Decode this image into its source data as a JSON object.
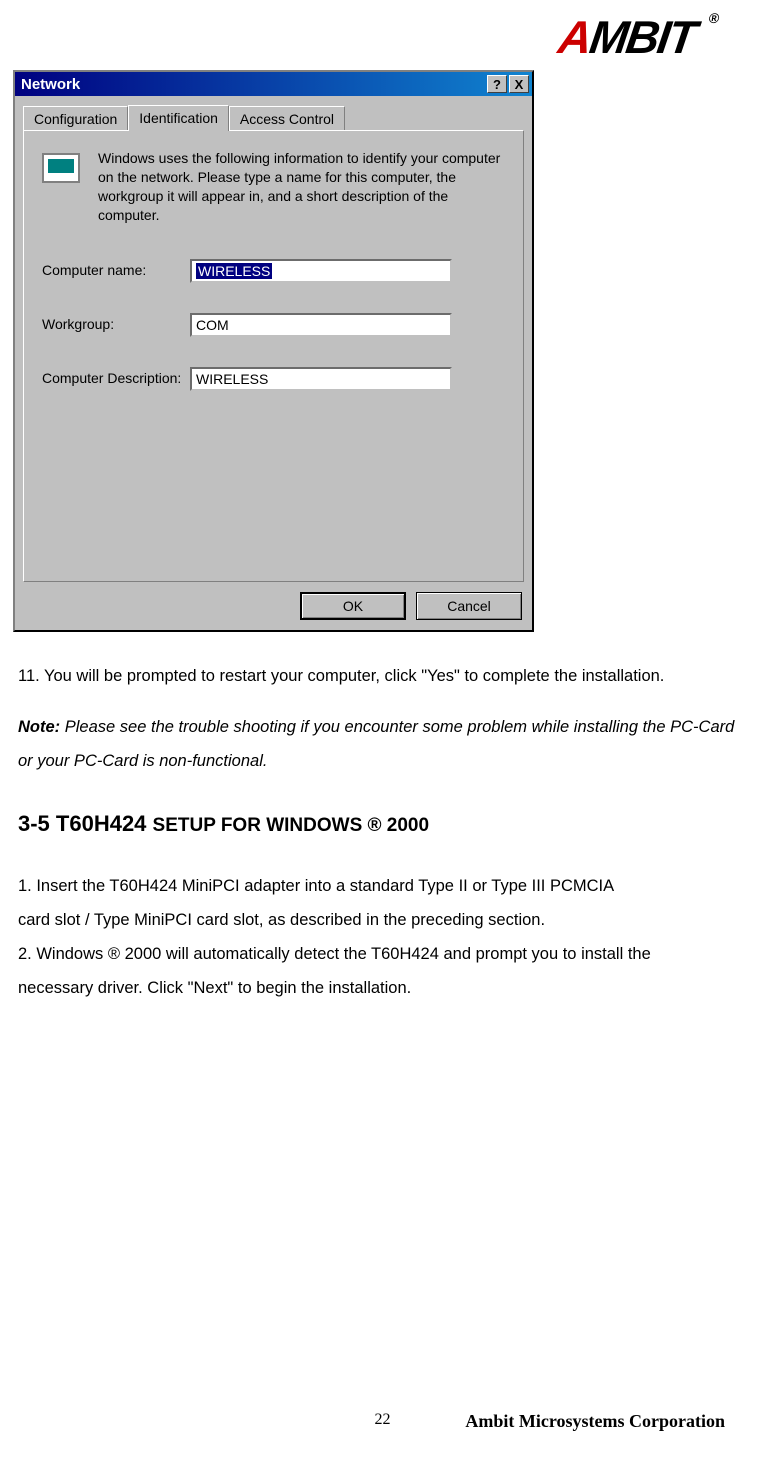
{
  "logo": {
    "text_a": "A",
    "text_mbit": "MBIT",
    "reg": "®"
  },
  "dialog": {
    "title": "Network",
    "help": "?",
    "close": "X",
    "tabs": {
      "configuration": "Configuration",
      "identification": "Identification",
      "access_control": "Access Control"
    },
    "intro": "Windows uses the following information to identify your computer on the network.  Please type a name for this computer, the workgroup it will appear in, and a short description of the computer.",
    "fields": {
      "computer_name": {
        "label": "Computer name:",
        "value": "WIRELESS"
      },
      "workgroup": {
        "label": "Workgroup:",
        "value": "COM"
      },
      "description": {
        "label": "Computer Description:",
        "value": "WIRELESS"
      }
    },
    "buttons": {
      "ok": "OK",
      "cancel": "Cancel"
    }
  },
  "doc": {
    "p11": "11. You will be prompted to restart your computer, click \"Yes\" to complete the installation.",
    "note_label": "Note:",
    "note_text": " Please see the trouble shooting if you encounter some problem while installing the PC-Card or your PC-Card is non-functional.",
    "heading_main": "3-5 T60H424 ",
    "heading_sub": "SETUP FOR WINDOWS ® 2000",
    "p1": "1. Insert the T60H424 MiniPCI adapter into a standard Type II or Type III PCMCIA",
    "p1b": "card slot / Type MiniPCI card slot, as described in the preceding section.",
    "p2": "2. Windows ® 2000 will automatically detect the T60H424 and prompt you to install the",
    "p2b": "necessary driver. Click \"Next\" to begin the installation."
  },
  "footer": {
    "page": "22",
    "corp": "Ambit Microsystems Corporation"
  }
}
